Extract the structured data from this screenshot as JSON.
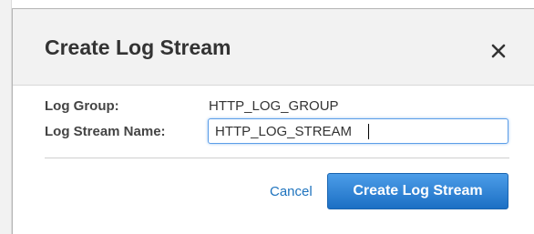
{
  "dialog": {
    "title": "Create Log Stream",
    "close_icon": "close-icon"
  },
  "form": {
    "log_group_label": "Log Group:",
    "log_group_value": "HTTP_LOG_GROUP",
    "log_stream_name_label": "Log Stream Name:",
    "log_stream_name_value": "HTTP_LOG_STREAM"
  },
  "footer": {
    "cancel_label": "Cancel",
    "create_label": "Create Log Stream"
  },
  "colors": {
    "primary_button": "#1c6fc4",
    "link": "#1e73be",
    "header_background": "#f2f2f2",
    "input_focus_border": "#5c9ee8"
  }
}
